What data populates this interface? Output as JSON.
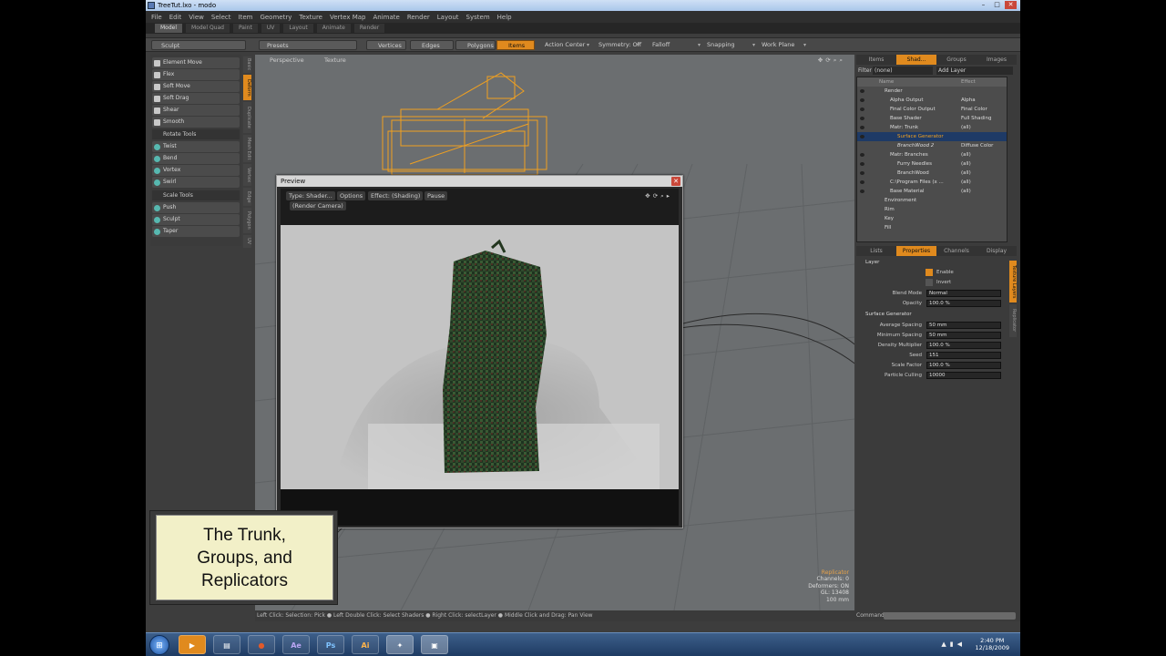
{
  "window": {
    "title": "TreeTut.lxo - modo",
    "controls": [
      "–",
      "□",
      "✕"
    ]
  },
  "menu": [
    "File",
    "Edit",
    "View",
    "Select",
    "Item",
    "Geometry",
    "Texture",
    "Vertex Map",
    "Animate",
    "Render",
    "Layout",
    "System",
    "Help"
  ],
  "layout_tabs": [
    "Model",
    "Model Quad",
    "Paint",
    "UV",
    "Layout",
    "Animate",
    "Render"
  ],
  "toolbar": {
    "sculpt": "Sculpt",
    "presets": "Presets",
    "vertices": "Vertices",
    "edges": "Edges",
    "polygons": "Polygons",
    "items": "Items",
    "action_center": "Action Center",
    "symmetry": "Symmetry: Off",
    "falloff": "Falloff",
    "snapping": "Snapping",
    "work_plane": "Work Plane"
  },
  "tools": {
    "deform": [
      "Element Move",
      "Flex",
      "Soft Move",
      "Soft Drag",
      "Shear",
      "Smooth"
    ],
    "rotate_head": "Rotate Tools",
    "rotate": [
      "Twist",
      "Bend",
      "Vortex",
      "Swirl"
    ],
    "scale_head": "Scale Tools",
    "scale": [
      "Push",
      "Sculpt",
      "Taper"
    ]
  },
  "side_tabs": [
    "Basic",
    "Deform",
    "Duplicate",
    "Mesh Edit",
    "Vertex",
    "Edge",
    "Polygon",
    "UV"
  ],
  "viewport": {
    "view": "Perspective",
    "shading": "Texture",
    "info": [
      "Replicator",
      "Channels: 0",
      "Deformers: ON",
      "GL: 13408",
      "100 mm"
    ]
  },
  "preview": {
    "title": "Preview",
    "type": "Type: Shader...",
    "options": "Options",
    "effect": "Effect: (Shading)",
    "pause": "Pause",
    "camera": "(Render Camera)"
  },
  "caption": "The Trunk,\nGroups, and\nReplicators",
  "status": "Left Click: Selection: Pick ● Left Double Click: Select Shaders ● Right Click: selectLayer ● Middle Click and Drag: Pan View",
  "shader_tabs": [
    "Items",
    "Shad...",
    "Groups",
    "Images"
  ],
  "filter": {
    "label": "Filter",
    "value": "(none)",
    "add": "Add Layer"
  },
  "shader_tree": {
    "headers": [
      "Name",
      "Effect"
    ],
    "rows": [
      {
        "name": "Render",
        "effect": ""
      },
      {
        "name": "Alpha Output",
        "effect": "Alpha"
      },
      {
        "name": "Final Color Output",
        "effect": "Final Color"
      },
      {
        "name": "Base Shader",
        "effect": "Full Shading"
      },
      {
        "name": "Matr: Trunk",
        "effect": "(all)"
      },
      {
        "name": "Surface Generator",
        "effect": ""
      },
      {
        "name": "BranchWood 2",
        "effect": "Diffuse Color"
      },
      {
        "name": "Matr: Branches",
        "effect": "(all)"
      },
      {
        "name": "Furry Needles",
        "effect": "(all)"
      },
      {
        "name": "BranchWood",
        "effect": "(all)"
      },
      {
        "name": "C:\\Program Files (x ...",
        "effect": "(all)"
      },
      {
        "name": "Base Material",
        "effect": "(all)"
      },
      {
        "name": "Environment",
        "effect": ""
      },
      {
        "name": "Rim",
        "effect": ""
      },
      {
        "name": "Key",
        "effect": ""
      },
      {
        "name": "Fill",
        "effect": ""
      }
    ]
  },
  "prop_tabs": [
    "Lists",
    "Properties",
    "Channels",
    "Display"
  ],
  "props": {
    "layer_head": "Layer",
    "enable": "Enable",
    "invert": "Invert",
    "blend_label": "Blend Mode",
    "blend_value": "Normal",
    "opacity_label": "Opacity",
    "opacity_value": "100.0 %",
    "gen_head": "Surface Generator",
    "avg_label": "Average Spacing",
    "avg_value": "50 mm",
    "min_label": "Minimum Spacing",
    "min_value": "50 mm",
    "dens_label": "Density Multiplier",
    "dens_value": "100.0 %",
    "seed_label": "Seed",
    "seed_value": "151",
    "scale_label": "Scale Factor",
    "scale_value": "100.0 %",
    "cull_label": "Particle Culling",
    "cull_value": "10000"
  },
  "prop_side_tabs": [
    "Texture Layers",
    "Replicator"
  ],
  "command_label": "Command",
  "taskbar": {
    "apps": [
      "▶",
      "▤",
      "●",
      "Ae",
      "Ps",
      "Ai",
      "✦",
      "▣"
    ],
    "time": "2:40 PM",
    "date": "12/18/2009"
  },
  "colors": {
    "accent": "#e08a1e",
    "selection": "#1e3a66",
    "caption_bg": "#f2f0c8"
  }
}
